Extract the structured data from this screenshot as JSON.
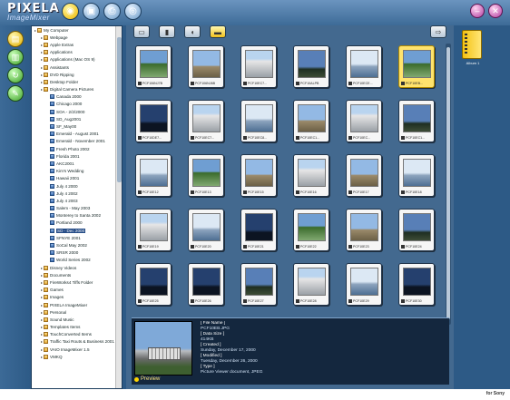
{
  "app": {
    "logo_line1": "PIXELA",
    "logo_line2": "ImageMixer",
    "brand": "for Sony"
  },
  "tree": {
    "items": [
      {
        "label": "My Computer",
        "depth": 0,
        "kind": "y"
      },
      {
        "label": "Webpage",
        "depth": 1,
        "kind": "y"
      },
      {
        "label": "Apple Extras",
        "depth": 1,
        "kind": "y"
      },
      {
        "label": "Applications",
        "depth": 1,
        "kind": "y"
      },
      {
        "label": "Applications (Mac OS 9)",
        "depth": 1,
        "kind": "y"
      },
      {
        "label": "Assistants",
        "depth": 1,
        "kind": "y"
      },
      {
        "label": "DVD Ripping",
        "depth": 1,
        "kind": "y"
      },
      {
        "label": "Desktop Folder",
        "depth": 1,
        "kind": "y"
      },
      {
        "label": "Digital Camera Pictures",
        "depth": 1,
        "kind": "y"
      },
      {
        "label": "Canada 2000",
        "depth": 2,
        "kind": "b"
      },
      {
        "label": "Chicago 2000",
        "depth": 2,
        "kind": "b"
      },
      {
        "label": "SOA - 2/2/2000",
        "depth": 2,
        "kind": "b"
      },
      {
        "label": "SD_Aug2001",
        "depth": 2,
        "kind": "b"
      },
      {
        "label": "SF_May00",
        "depth": 2,
        "kind": "b"
      },
      {
        "label": "Emerald - August 2001",
        "depth": 2,
        "kind": "b"
      },
      {
        "label": "Emerald - November 2001",
        "depth": 2,
        "kind": "b"
      },
      {
        "label": "Fresh Photo 2002",
        "depth": 2,
        "kind": "b"
      },
      {
        "label": "Florida 2001",
        "depth": 2,
        "kind": "b"
      },
      {
        "label": "AKC2001",
        "depth": 2,
        "kind": "b"
      },
      {
        "label": "Kim's Wedding",
        "depth": 2,
        "kind": "b"
      },
      {
        "label": "Hawaii 2001",
        "depth": 2,
        "kind": "b"
      },
      {
        "label": "July 4 2000",
        "depth": 2,
        "kind": "b"
      },
      {
        "label": "July 4 2002",
        "depth": 2,
        "kind": "b"
      },
      {
        "label": "July 4 2003",
        "depth": 2,
        "kind": "b"
      },
      {
        "label": "Salem - May 2003",
        "depth": 2,
        "kind": "b"
      },
      {
        "label": "Monterey to Santa 2002",
        "depth": 2,
        "kind": "b"
      },
      {
        "label": "Portland 2000",
        "depth": 2,
        "kind": "b"
      },
      {
        "label": "SD - Dec 2000",
        "depth": 2,
        "kind": "b",
        "selected": true
      },
      {
        "label": "SFNYE 2001",
        "depth": 2,
        "kind": "b"
      },
      {
        "label": "SoCal May 2002",
        "depth": 2,
        "kind": "b"
      },
      {
        "label": "SRSR 2000",
        "depth": 2,
        "kind": "b"
      },
      {
        "label": "World Series 2002",
        "depth": 2,
        "kind": "b"
      },
      {
        "label": "Disney Videos",
        "depth": 1,
        "kind": "y"
      },
      {
        "label": "Documents",
        "depth": 1,
        "kind": "y"
      },
      {
        "label": "FireWorks4 Tiffs Folder",
        "depth": 1,
        "kind": "y"
      },
      {
        "label": "Games",
        "depth": 1,
        "kind": "y"
      },
      {
        "label": "Images",
        "depth": 1,
        "kind": "y"
      },
      {
        "label": "PIXELA ImageMixer",
        "depth": 1,
        "kind": "y"
      },
      {
        "label": "Personal",
        "depth": 1,
        "kind": "y"
      },
      {
        "label": "Sound Music",
        "depth": 1,
        "kind": "y"
      },
      {
        "label": "Templates Items",
        "depth": 1,
        "kind": "y"
      },
      {
        "label": "TouchConverted Items",
        "depth": 1,
        "kind": "y"
      },
      {
        "label": "Traffic Taxi Routs & Business 2001",
        "depth": 1,
        "kind": "y"
      },
      {
        "label": "VAIO ImageMixer 1.5",
        "depth": 1,
        "kind": "y"
      },
      {
        "label": "VMKQ",
        "depth": 1,
        "kind": "y"
      }
    ]
  },
  "thumbnails": [
    {
      "caption": "PCF106NJ7B",
      "style": "p1",
      "selected": false
    },
    {
      "caption": "PCF106NJ6B",
      "style": "p2",
      "selected": false
    },
    {
      "caption": "PCF10EC7...",
      "style": "p3",
      "selected": false
    },
    {
      "caption": "PCF10ALPB",
      "style": "p4",
      "selected": false
    },
    {
      "caption": "PCF10ECE...",
      "style": "p5",
      "selected": false
    },
    {
      "caption": "PCF10EB...",
      "style": "p1",
      "selected": true
    },
    {
      "caption": "PCF10DE7...",
      "style": "p6",
      "selected": false
    },
    {
      "caption": "PCF10EC7...",
      "style": "p3",
      "selected": false
    },
    {
      "caption": "PCF10EC8...",
      "style": "p5",
      "selected": false
    },
    {
      "caption": "PCF10EC1...",
      "style": "p2",
      "selected": false
    },
    {
      "caption": "PCF10EC...",
      "style": "p3",
      "selected": false
    },
    {
      "caption": "PCF10EC1...",
      "style": "p4",
      "selected": false
    },
    {
      "caption": "PCF10E12",
      "style": "p5",
      "selected": false
    },
    {
      "caption": "PCF10E13",
      "style": "p1",
      "selected": false
    },
    {
      "caption": "PCF10E15",
      "style": "p2",
      "selected": false
    },
    {
      "caption": "PCF10E16",
      "style": "p3",
      "selected": false
    },
    {
      "caption": "PCF10E17",
      "style": "p2",
      "selected": false
    },
    {
      "caption": "PCF10E18",
      "style": "p5",
      "selected": false
    },
    {
      "caption": "PCF10E19",
      "style": "p3",
      "selected": false
    },
    {
      "caption": "PCF10E20",
      "style": "p5",
      "selected": false
    },
    {
      "caption": "PCF10E21",
      "style": "p6",
      "selected": false
    },
    {
      "caption": "PCF10E22",
      "style": "p1",
      "selected": false
    },
    {
      "caption": "PCF10E23",
      "style": "p2",
      "selected": false
    },
    {
      "caption": "PCF10E24",
      "style": "p4",
      "selected": false
    },
    {
      "caption": "PCF10E25",
      "style": "p6",
      "selected": false
    },
    {
      "caption": "PCF10E26",
      "style": "p6",
      "selected": false
    },
    {
      "caption": "PCF10E27",
      "style": "p4",
      "selected": false
    },
    {
      "caption": "PCF10E28",
      "style": "p3",
      "selected": false
    },
    {
      "caption": "PCF10E29",
      "style": "p5",
      "selected": false
    },
    {
      "caption": "PCF10E30",
      "style": "p6",
      "selected": false
    }
  ],
  "preview": {
    "label": "Preview"
  },
  "info": {
    "file_name_key": "[ File Name ]",
    "file_name": "PCF10EB.JPG",
    "data_size_key": "[ Data Size ]",
    "data_size": "414KB",
    "created_key": "[ Created ]",
    "created": "Sunday, December 17, 2000",
    "modified_key": "[ Modified ]",
    "modified": "Tuesday, December 26, 2000",
    "type_key": "[ Type ]",
    "type": "Picture Viewer document, JPEG"
  },
  "album": {
    "label": "Album 1"
  }
}
